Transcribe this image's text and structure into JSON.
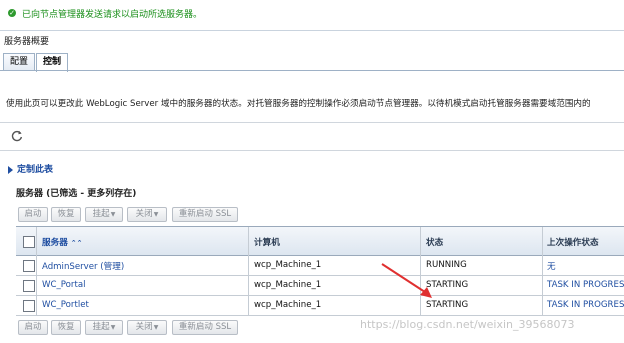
{
  "message": {
    "text": "已向节点管理器发送请求以启动所选服务器。"
  },
  "page": {
    "title": "服务器概要"
  },
  "tabs": [
    {
      "label": "配置"
    },
    {
      "label": "控制"
    }
  ],
  "description": "使用此页可以更改此 WebLogic Server 域中的服务器的状态。对托管服务器的控制操作必须启动节点管理器。以待机模式启动托管服务器需要域范围内的",
  "customize": {
    "label": "定制此表"
  },
  "table": {
    "title": "服务器 (已筛选 - 更多列存在)",
    "toolbar": {
      "start": "启动",
      "resume": "恢复",
      "suspend": "挂起",
      "shutdown": "关闭",
      "restart_ssl": "重新启动 SSL"
    },
    "columns": {
      "server": "服务器",
      "machine": "计算机",
      "state": "状态",
      "last_action": "上次操作状态"
    },
    "rows": [
      {
        "server": "AdminServer (管理)",
        "machine": "wcp_Machine_1",
        "state": "RUNNING",
        "last_action": "无"
      },
      {
        "server": "WC_Portal",
        "machine": "wcp_Machine_1",
        "state": "STARTING",
        "last_action": "TASK IN PROGRESS"
      },
      {
        "server": "WC_Portlet",
        "machine": "wcp_Machine_1",
        "state": "STARTING",
        "last_action": "TASK IN PROGRESS"
      }
    ]
  },
  "watermark": "https://blog.csdn.net/weixin_39568073",
  "colors": {
    "link": "#1f4ea1",
    "success": "#1a8f1a",
    "annotation_arrow": "#e03030"
  }
}
